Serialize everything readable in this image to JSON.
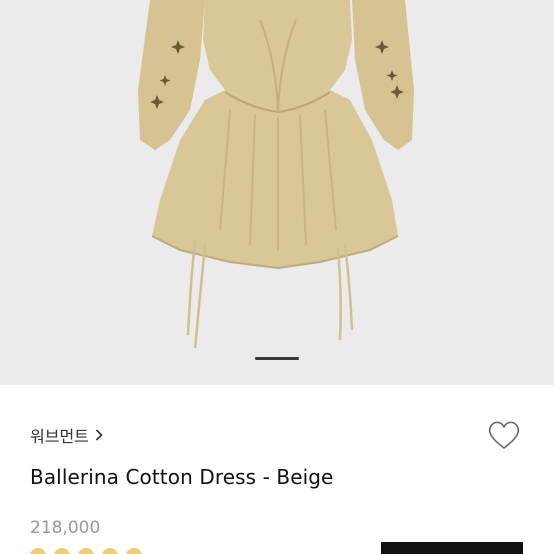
{
  "product": {
    "brand_label": "워브먼트",
    "name": "Ballerina Cotton Dress - Beige",
    "price": "218,000"
  },
  "carousel": {
    "active_index": 1,
    "indicator_color": "#3a3a3a"
  },
  "colors": {
    "image_bg": "#ebebeb",
    "dress": "#d9c797",
    "dress_shadow": "#c8b483",
    "star_rating": "#f2c04a",
    "button": "#111111"
  },
  "icons": {
    "brand_arrow": "chevron-right-icon",
    "wishlist": "heart-outline-icon"
  }
}
